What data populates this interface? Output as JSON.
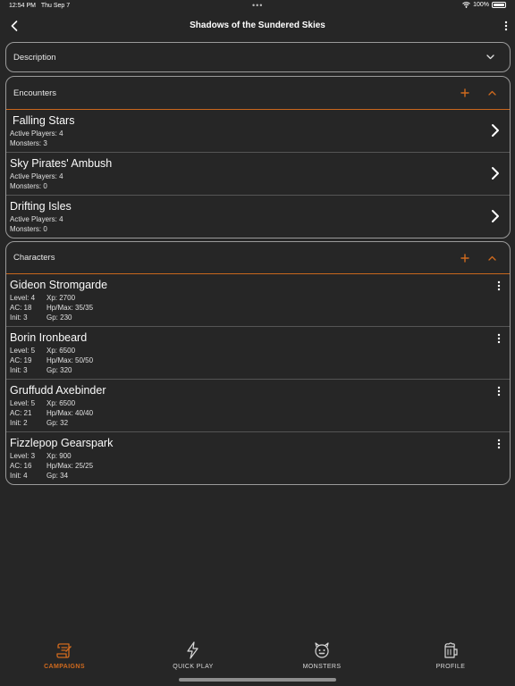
{
  "status_bar": {
    "time": "12:54 PM",
    "date": "Thu Sep 7",
    "battery": "100%"
  },
  "nav": {
    "title": "Shadows of the Sundered Skies"
  },
  "description": {
    "label": "Description"
  },
  "encounters": {
    "label": "Encounters",
    "items": [
      {
        "name": "Falling Stars",
        "players": "Active Players: 4",
        "monsters": "Monsters: 3"
      },
      {
        "name": "Sky Pirates' Ambush",
        "players": "Active Players: 4",
        "monsters": "Monsters: 0"
      },
      {
        "name": "Drifting Isles",
        "players": "Active Players: 4",
        "monsters": "Monsters: 0"
      }
    ]
  },
  "characters": {
    "label": "Characters",
    "items": [
      {
        "name": "Gideon Stromgarde",
        "level": "Level: 4",
        "xp": "Xp: 2700",
        "ac": "AC: 18",
        "hp": "Hp/Max: 35/35",
        "init": "Init: 3",
        "gp": "Gp: 230"
      },
      {
        "name": "Borin Ironbeard",
        "level": "Level: 5",
        "xp": "Xp: 6500",
        "ac": "AC: 19",
        "hp": "Hp/Max: 50/50",
        "init": "Init: 3",
        "gp": "Gp: 320"
      },
      {
        "name": "Gruffudd Axebinder",
        "level": "Level: 5",
        "xp": "Xp: 6500",
        "ac": "AC: 21",
        "hp": "Hp/Max: 40/40",
        "init": "Init: 2",
        "gp": "Gp: 32"
      },
      {
        "name": "Fizzlepop Gearspark",
        "level": "Level: 3",
        "xp": "Xp: 900",
        "ac": "AC: 16",
        "hp": "Hp/Max: 25/25",
        "init": "Init: 4",
        "gp": "Gp: 34"
      }
    ]
  },
  "tabs": [
    {
      "label": "CAMPAIGNS",
      "icon": "scroll-icon",
      "active": true
    },
    {
      "label": "QUICK PLAY",
      "icon": "lightning-icon",
      "active": false
    },
    {
      "label": "MONSTERS",
      "icon": "monster-icon",
      "active": false
    },
    {
      "label": "PROFILE",
      "icon": "tankard-icon",
      "active": false
    }
  ],
  "colors": {
    "accent": "#d06a1e",
    "background": "#262626",
    "card_border": "#9a9a9a",
    "divider": "#c9671d"
  }
}
